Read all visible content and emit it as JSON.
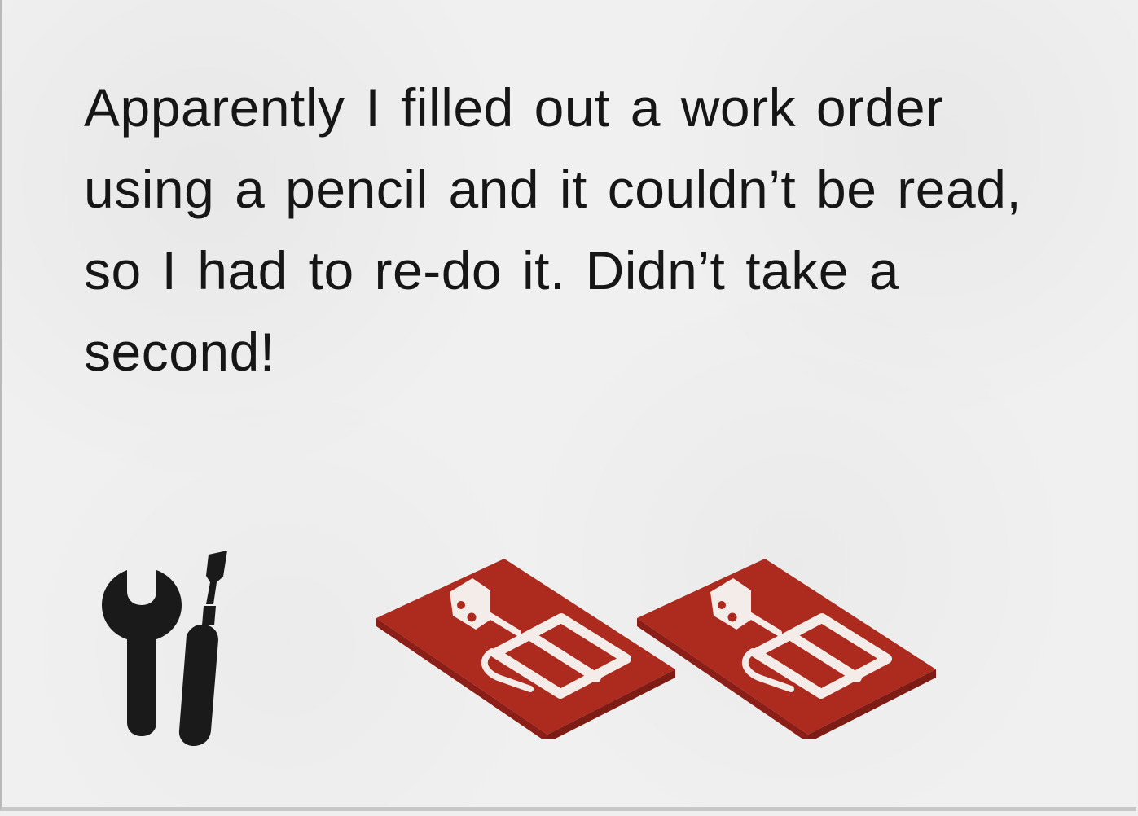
{
  "story": {
    "text": "Apparently I filled out a work order\nusing a pencil and it couldn’t be read,\nso I had to re-do it. Didn’t take a\nsecond!"
  },
  "icons": {
    "tools": "wrench-screwdriver-icon",
    "trap": "mousetrap-icon",
    "trap_count": 2
  },
  "colors": {
    "text": "#161616",
    "icon_dark": "#1a1a1a",
    "trap_red": "#ad2a1f",
    "trap_detail": "#f3ece8",
    "background": "#f0f0f0"
  }
}
